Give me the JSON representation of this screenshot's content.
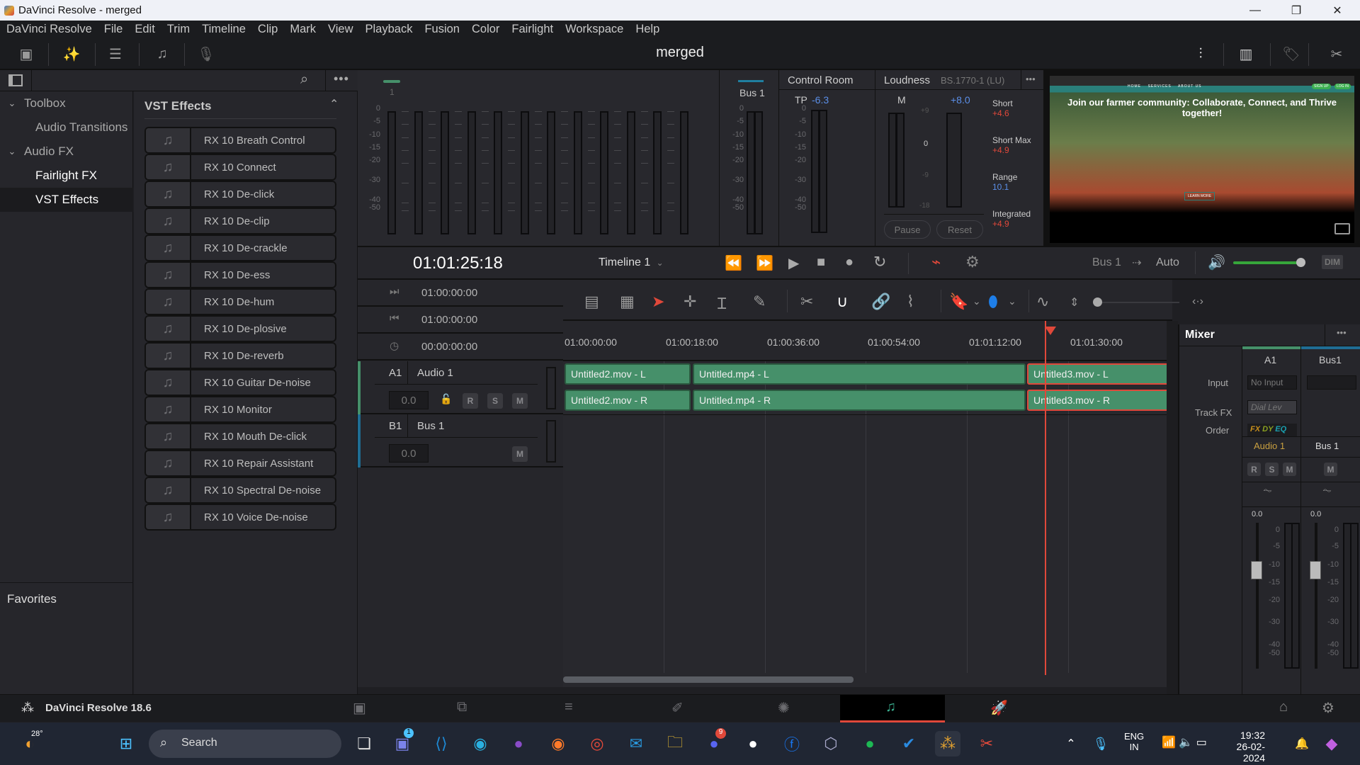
{
  "window": {
    "title": "DaVinci Resolve - merged",
    "minimize": "—",
    "restore": "❐",
    "close": "✕"
  },
  "menu": [
    "DaVinci Resolve",
    "File",
    "Edit",
    "Trim",
    "Timeline",
    "Clip",
    "Mark",
    "View",
    "Playback",
    "Fusion",
    "Color",
    "Fairlight",
    "Workspace",
    "Help"
  ],
  "toolbar": {
    "project_title": "merged"
  },
  "sidebar": {
    "items": [
      {
        "label": "Toolbox",
        "chevron": "⌄"
      },
      {
        "label": "Audio Transitions"
      },
      {
        "label": "Audio FX",
        "chevron": "⌄"
      },
      {
        "label": "Fairlight FX"
      },
      {
        "label": "VST Effects"
      }
    ],
    "favorites": "Favorites"
  },
  "fx_panel": {
    "title": "VST Effects",
    "items": [
      "RX 10 Breath Control",
      "RX 10 Connect",
      "RX 10 De-click",
      "RX 10 De-clip",
      "RX 10 De-crackle",
      "RX 10 De-ess",
      "RX 10 De-hum",
      "RX 10 De-plosive",
      "RX 10 De-reverb",
      "RX 10 Guitar De-noise",
      "RX 10 Monitor",
      "RX 10 Mouth De-click",
      "RX 10 Repair Assistant",
      "RX 10 Spectral De-noise",
      "RX 10 Voice De-noise"
    ]
  },
  "meters": {
    "channel_label": "1",
    "scale": [
      "0",
      "-5",
      "-10",
      "-15",
      "-20",
      "-30",
      "-40",
      "-50"
    ],
    "bus_label": "Bus 1"
  },
  "control_room": {
    "title": "Control Room",
    "tp_label": "TP",
    "tp_value": "-6.3"
  },
  "loudness": {
    "title": "Loudness",
    "standard": "BS.1770-1 (LU)",
    "m_label": "M",
    "m_value": "+8.0",
    "scale": [
      "+9",
      "0",
      "-9",
      "-18"
    ],
    "stats": [
      {
        "label": "Short",
        "value": "+4.6",
        "color": "#e0483a"
      },
      {
        "label": "Short Max",
        "value": "+4.9",
        "color": "#e0483a"
      },
      {
        "label": "Range",
        "value": "10.1",
        "color": "#5b8fe8"
      },
      {
        "label": "Integrated",
        "value": "+4.9",
        "color": "#e0483a"
      }
    ],
    "pause": "Pause",
    "reset": "Reset"
  },
  "viewer": {
    "headline": "Join our farmer community: Collaborate, Connect, and Thrive together!",
    "nav": [
      "HOME",
      "SERVICES",
      "ABOUT US"
    ],
    "signup": "SIGN UP",
    "login": "LOG IN",
    "cta": "LEARN MORE"
  },
  "transport": {
    "timecode": "01:01:25:18",
    "timeline": "Timeline 1",
    "bus": "Bus 1",
    "arrow": "⇢",
    "auto": "Auto",
    "dim": "DIM",
    "volume_level": 0.95
  },
  "timecodes": [
    {
      "icon": "⏭",
      "value": "01:00:00:00"
    },
    {
      "icon": "⏮",
      "value": "01:00:00:00"
    },
    {
      "icon": "◷",
      "value": "00:00:00:00"
    }
  ],
  "ruler": [
    "01:00:00:00",
    "01:00:18:00",
    "01:00:36:00",
    "01:00:54:00",
    "01:01:12:00",
    "01:01:30:00"
  ],
  "tracks": [
    {
      "id": "A1",
      "name": "Audio 1",
      "volume": "0.0",
      "buttons": [
        "R",
        "S",
        "M"
      ],
      "color": "#46906a"
    },
    {
      "id": "B1",
      "name": "Bus 1",
      "volume": "0.0",
      "buttons": [
        "M"
      ],
      "color": "#1f6d94"
    }
  ],
  "clips": {
    "a1": [
      "Untitled2.mov - L",
      "Untitled.mp4 - L",
      "Untitled3.mov - L"
    ],
    "a2": [
      "Untitled2.mov - R",
      "Untitled.mp4 - R",
      "Untitled3.mov - R"
    ]
  },
  "mixer": {
    "title": "Mixer",
    "columns": [
      "A1",
      "Bus1"
    ],
    "row_labels": [
      "Input",
      "Track FX",
      "Order"
    ],
    "input_a1": "No Input",
    "trackfx_a1": "Dial Lev",
    "order": [
      "FX",
      "DY",
      "EQ"
    ],
    "names": [
      "Audio 1",
      "Bus 1"
    ],
    "a1_buttons": [
      "R",
      "S",
      "M"
    ],
    "bus_buttons": [
      "M"
    ],
    "fader_values": [
      "0.0",
      "0.0"
    ],
    "scale": [
      "0",
      "-5",
      "-10",
      "-15",
      "-20",
      "-30",
      "-40",
      "-50"
    ]
  },
  "pagebar": {
    "app": "DaVinci Resolve 18.6"
  },
  "taskbar": {
    "weather": "28°",
    "search": "Search",
    "lang1": "ENG",
    "lang2": "IN",
    "time": "19:32",
    "date": "26-02-2024",
    "teams_badge": "1",
    "discord_badge": "9"
  }
}
